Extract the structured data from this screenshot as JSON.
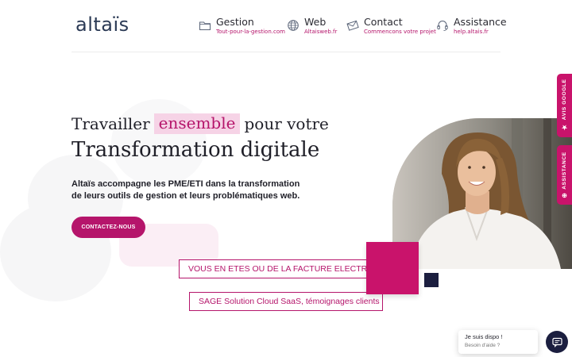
{
  "brand": {
    "logo_text": "altaïs"
  },
  "nav": [
    {
      "title": "Gestion",
      "subtitle": "Tout-pour-la-gestion.com",
      "icon": "folder-icon"
    },
    {
      "title": "Web",
      "subtitle": "Altaisweb.fr",
      "icon": "globe-icon"
    },
    {
      "title": "Contact",
      "subtitle": "Commencons votre projet",
      "icon": "envelope-icon"
    },
    {
      "title": "Assistance",
      "subtitle": "help.altais.fr",
      "icon": "headset-icon"
    }
  ],
  "hero": {
    "line1_before": "Travailler",
    "line1_highlight": "ensemble",
    "line1_after": "pour votre",
    "line2": "Transformation digitale",
    "description": "Altaïs accompagne les PME/ETI dans la transformation de leurs outils de gestion et leurs problématiques web.",
    "cta_label": "CONTACTEZ-NOUS"
  },
  "links": {
    "invoice": "VOUS EN ETES OU DE LA FACTURE ELECTRONIQUE",
    "sage": "SAGE Solution Cloud SaaS, témoignages clients"
  },
  "side_tabs": {
    "google": "AVIS GOOGLE",
    "assistance": "ASSISTANCE"
  },
  "chat": {
    "title": "Je suis dispo !",
    "subtitle": "Besoin d'aide ?"
  },
  "colors": {
    "accent": "#b5156b",
    "accent_light": "#f6d3e6",
    "navy": "#1b1e3f",
    "logo": "#2b3a55"
  }
}
